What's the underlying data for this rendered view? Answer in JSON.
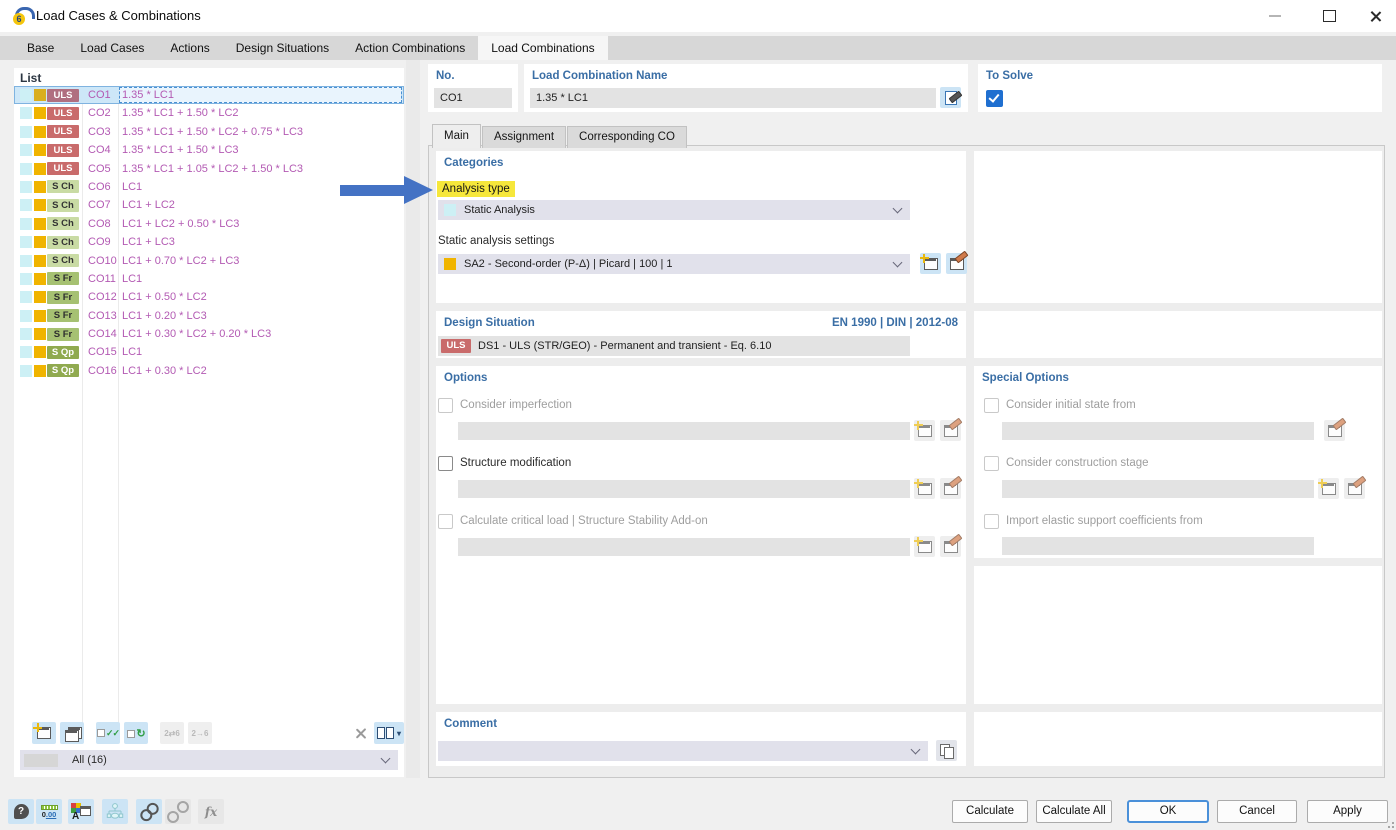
{
  "window": {
    "title": "Load Cases & Combinations"
  },
  "main_tabs": {
    "items": [
      "Base",
      "Load Cases",
      "Actions",
      "Design Situations",
      "Action Combinations",
      "Load Combinations"
    ],
    "active": "Load Combinations"
  },
  "list": {
    "title": "List",
    "filter_value": "All (16)",
    "rows": [
      {
        "id": "CO1",
        "badge": "ULS",
        "kind": "uls",
        "formula": "1.35 * LC1",
        "selected": true
      },
      {
        "id": "CO2",
        "badge": "ULS",
        "kind": "uls",
        "formula": "1.35 * LC1 + 1.50 * LC2"
      },
      {
        "id": "CO3",
        "badge": "ULS",
        "kind": "uls",
        "formula": "1.35 * LC1 + 1.50 * LC2 + 0.75 * LC3"
      },
      {
        "id": "CO4",
        "badge": "ULS",
        "kind": "uls",
        "formula": "1.35 * LC1 + 1.50 * LC3"
      },
      {
        "id": "CO5",
        "badge": "ULS",
        "kind": "uls",
        "formula": "1.35 * LC1 + 1.05 * LC2 + 1.50 * LC3"
      },
      {
        "id": "CO6",
        "badge": "S Ch",
        "kind": "sch",
        "formula": "LC1"
      },
      {
        "id": "CO7",
        "badge": "S Ch",
        "kind": "sch",
        "formula": "LC1 + LC2"
      },
      {
        "id": "CO8",
        "badge": "S Ch",
        "kind": "sch",
        "formula": "LC1 + LC2 + 0.50 * LC3"
      },
      {
        "id": "CO9",
        "badge": "S Ch",
        "kind": "sch",
        "formula": "LC1 + LC3"
      },
      {
        "id": "CO10",
        "badge": "S Ch",
        "kind": "sch",
        "formula": "LC1 + 0.70 * LC2 + LC3"
      },
      {
        "id": "CO11",
        "badge": "S Fr",
        "kind": "sfr",
        "formula": "LC1"
      },
      {
        "id": "CO12",
        "badge": "S Fr",
        "kind": "sfr",
        "formula": "LC1 + 0.50 * LC2"
      },
      {
        "id": "CO13",
        "badge": "S Fr",
        "kind": "sfr",
        "formula": "LC1 + 0.20 * LC3"
      },
      {
        "id": "CO14",
        "badge": "S Fr",
        "kind": "sfr",
        "formula": "LC1 + 0.30 * LC2 + 0.20 * LC3"
      },
      {
        "id": "CO15",
        "badge": "S Qp",
        "kind": "sqp",
        "formula": "LC1"
      },
      {
        "id": "CO16",
        "badge": "S Qp",
        "kind": "sqp",
        "formula": "LC1 + 0.30 * LC2"
      }
    ]
  },
  "header": {
    "no_label": "No.",
    "no_value": "CO1",
    "name_label": "Load Combination Name",
    "name_value": "1.35 * LC1",
    "to_solve_label": "To Solve",
    "to_solve_checked": true
  },
  "sub_tabs": {
    "items": [
      "Main",
      "Assignment",
      "Corresponding CO"
    ],
    "active": "Main"
  },
  "categories": {
    "heading": "Categories",
    "analysis_type_label": "Analysis type",
    "analysis_type_value": "Static Analysis",
    "settings_label": "Static analysis settings",
    "settings_value": "SA2 - Second-order (P-Δ) | Picard | 100 | 1"
  },
  "design_situation": {
    "heading": "Design Situation",
    "standard": "EN 1990 | DIN | 2012-08",
    "badge": "ULS",
    "value": "DS1 - ULS (STR/GEO) - Permanent and transient - Eq. 6.10"
  },
  "options": {
    "heading": "Options",
    "items": [
      {
        "label": "Consider imperfection",
        "enabled": false,
        "checked": false
      },
      {
        "label": "Structure modification",
        "enabled": true,
        "checked": false
      },
      {
        "label": "Calculate critical load | Structure Stability Add-on",
        "enabled": false,
        "checked": false
      }
    ]
  },
  "special_options": {
    "heading": "Special Options",
    "items": [
      {
        "label": "Consider initial state from",
        "enabled": false,
        "checked": false
      },
      {
        "label": "Consider construction stage",
        "enabled": false,
        "checked": false
      },
      {
        "label": "Import elastic support coefficients from",
        "enabled": false,
        "checked": false
      }
    ]
  },
  "comment": {
    "heading": "Comment",
    "value": ""
  },
  "footer": {
    "calculate": "Calculate",
    "calculate_all": "Calculate All",
    "ok": "OK",
    "cancel": "Cancel",
    "apply": "Apply"
  },
  "colors": {
    "heading_blue": "#3a6ea5",
    "list_text": "#b35ab3",
    "uls_badge": "#c96b6b",
    "sch_badge": "#c9dba4",
    "sfr_badge": "#a6c172",
    "sqp_badge": "#90aa4f",
    "analysis_swatch": "#cdf0f5",
    "settings_swatch": "#f0b400",
    "selection": "#cde7f8",
    "highlight_yellow": "#f6e73b",
    "arrow_blue": "#4472c4",
    "checkbox_blue": "#1f6fd0"
  },
  "icons": {
    "app-icon": "rfem-6-logo",
    "minimize-icon": "—",
    "maximize-icon": "▢",
    "close-icon": "✕",
    "edit-name-icon": "pencil",
    "combo-caret-icon": "⌄",
    "new-item-icon": "window+star",
    "edit-item-icon": "window+pencil",
    "copy-item-icon": "two-windows",
    "check-all-icon": "✓✓",
    "toggle-check-icon": "✓ refresh",
    "renumber-icon": "2⇄6",
    "renumber-all-icon": "2→6",
    "delete-icon": "✕",
    "columns-icon": "▯▯▾",
    "help-icon": "? balloon",
    "decimals-icon": "0.00",
    "display-options-icon": "A + color grid",
    "structure-tree-icon": "branch nodes",
    "link-icon": "chain",
    "unlink-icon": "broken chain",
    "function-icon": "fx",
    "comment-copy-icon": "stacked sheets",
    "resize-grip-icon": "⋰"
  }
}
